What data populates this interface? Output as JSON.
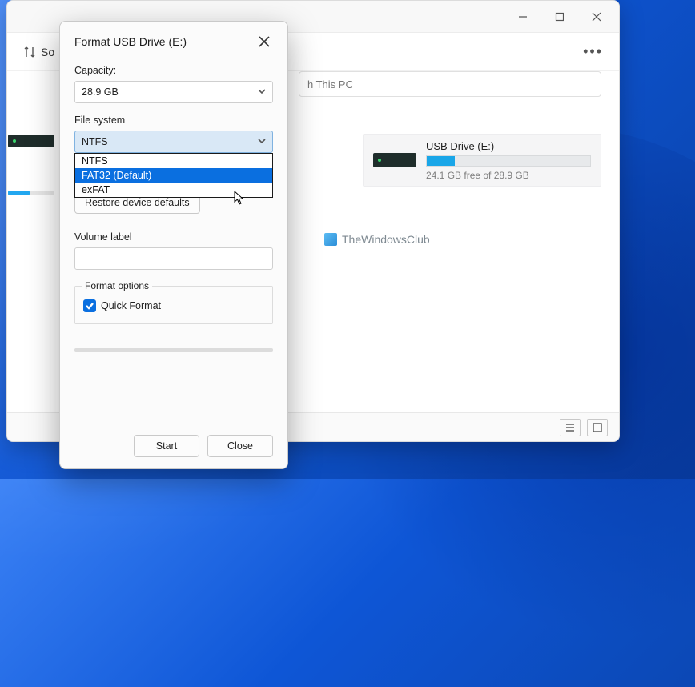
{
  "explorer": {
    "toolbar_sort_label": "So",
    "search_placeholder": "h This PC",
    "drive": {
      "name": "USB Drive (E:)",
      "free_text": "24.1 GB free of 28.9 GB",
      "fill_percent": 17
    },
    "watermark": "TheWindowsClub"
  },
  "dialog": {
    "title": "Format USB Drive (E:)",
    "capacity_label": "Capacity:",
    "capacity_value": "28.9 GB",
    "filesystem_label": "File system",
    "filesystem_value": "NTFS",
    "filesystem_options": [
      "NTFS",
      "FAT32 (Default)",
      "exFAT"
    ],
    "restore_label": "Restore device defaults",
    "volume_label": "Volume label",
    "volume_value": "",
    "format_options_label": "Format options",
    "quick_format_label": "Quick Format",
    "start_label": "Start",
    "close_label": "Close"
  }
}
